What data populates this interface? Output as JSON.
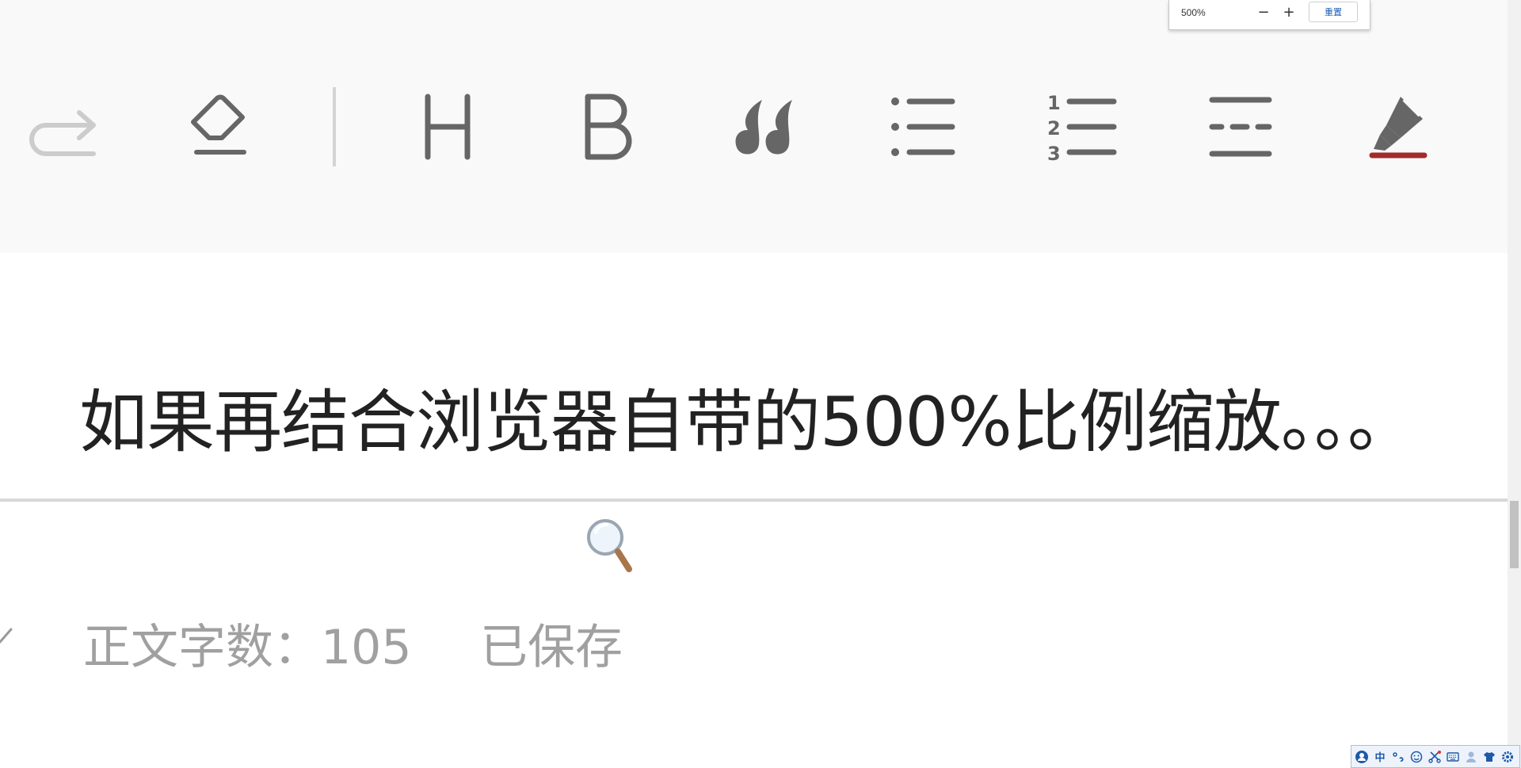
{
  "toolbar": {
    "icons": [
      {
        "name": "redo-icon",
        "enabled": false
      },
      {
        "name": "eraser-icon",
        "enabled": true
      },
      {
        "name": "heading-icon",
        "enabled": true
      },
      {
        "name": "bold-icon",
        "enabled": true
      },
      {
        "name": "quote-icon",
        "enabled": true
      },
      {
        "name": "bullet-list-icon",
        "enabled": true
      },
      {
        "name": "numbered-list-icon",
        "enabled": true
      },
      {
        "name": "divider-line-icon",
        "enabled": true
      },
      {
        "name": "highlighter-icon",
        "enabled": true
      }
    ],
    "heading_glyph": "H",
    "bold_glyph": "B",
    "numbered_list_numbers": [
      "1",
      "2",
      "3"
    ],
    "icon_color": "#666666",
    "disabled_color": "#cccccc",
    "highlight_color": "#a32b2b"
  },
  "editor": {
    "content_text": "如果再结合浏览器自带的500%比例缩放。。。"
  },
  "footer": {
    "word_count_label": "正文字数：105",
    "save_status": "已保存"
  },
  "zoom_popup": {
    "zoom_value": "500%",
    "minus_label": "−",
    "plus_label": "+",
    "reset_label": "重置"
  },
  "ime_toolbar": {
    "icons": [
      "user-icon",
      "chinese-mode",
      "punctuation-icon",
      "emoji-icon",
      "scissors-icon",
      "keyboard-icon",
      "person-icon",
      "shirt-icon",
      "settings-icon"
    ],
    "chinese_mode_label": "中"
  }
}
